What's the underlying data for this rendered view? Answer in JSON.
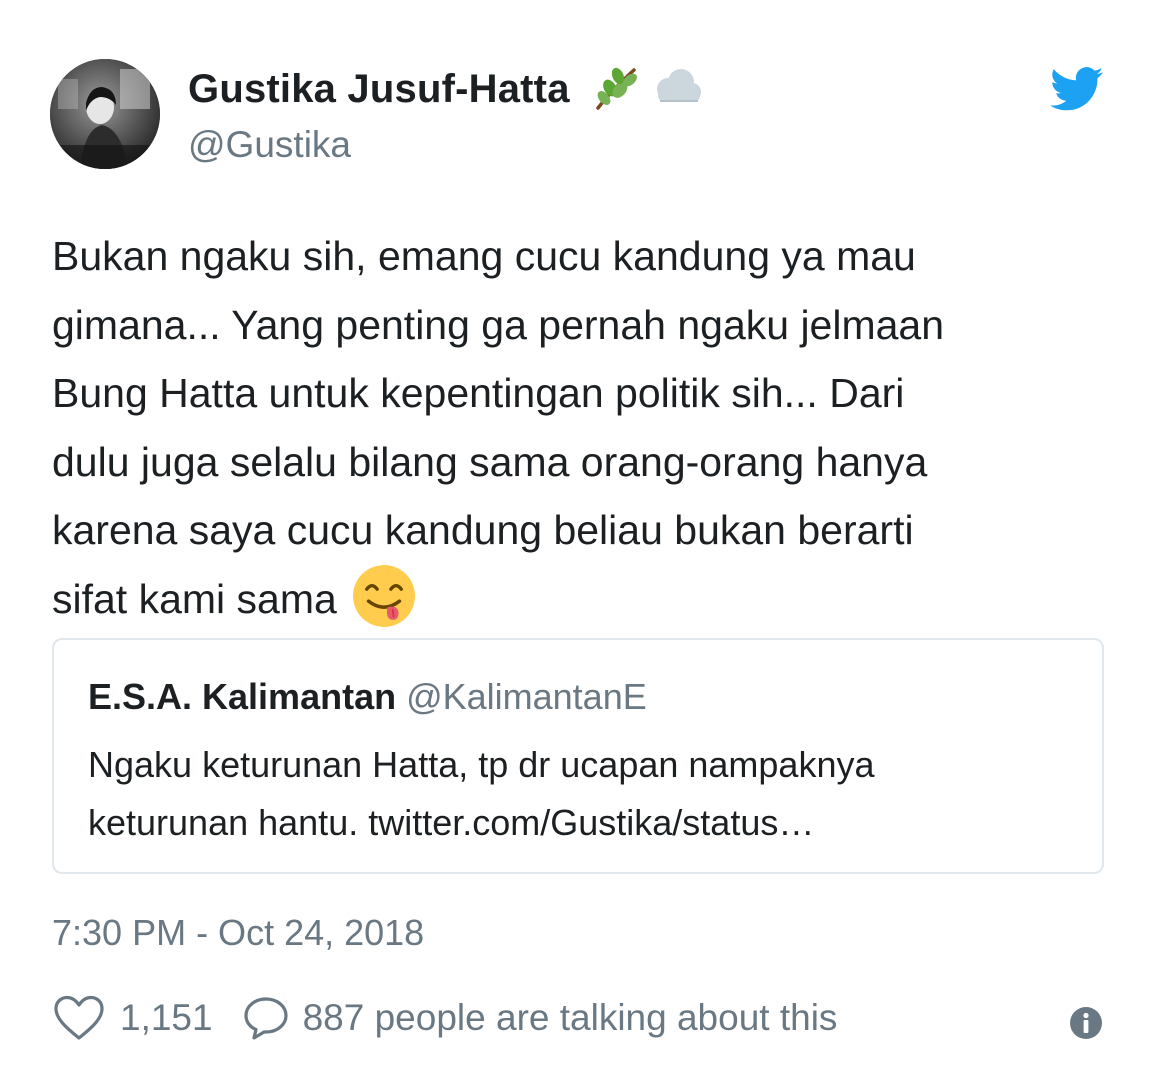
{
  "user": {
    "name": "Gustika Jusuf-Hatta",
    "handle": "@Gustika",
    "name_emojis": [
      "herb-emoji",
      "cloud-emoji"
    ]
  },
  "tweet": {
    "lines": [
      "Bukan ngaku sih, emang cucu kandung ya mau",
      "gimana... Yang penting ga pernah ngaku jelmaan",
      "Bung Hatta untuk kepentingan politik sih... Dari",
      "dulu juga selalu bilang sama orang-orang hanya",
      "karena saya cucu kandung beliau bukan berarti",
      "sifat kami sama"
    ],
    "trailing_emoji": "savoring-food-emoji"
  },
  "quoted": {
    "name": "E.S.A. Kalimantan",
    "handle": "@KalimantanE",
    "lines": [
      "Ngaku keturunan Hatta, tp dr ucapan nampaknya",
      "keturunan hantu. twitter.com/Gustika/status…"
    ]
  },
  "timestamp": "7:30 PM - Oct 24, 2018",
  "actions": {
    "likes": "1,151",
    "talking": "887 people are talking about this"
  },
  "colors": {
    "text": "#1c2022",
    "secondary": "#697882",
    "twitter_blue": "#1da1f2",
    "border": "#e1e8ed"
  },
  "icons": [
    "twitter-bird-icon",
    "heart-icon",
    "speech-bubble-icon",
    "info-icon"
  ]
}
